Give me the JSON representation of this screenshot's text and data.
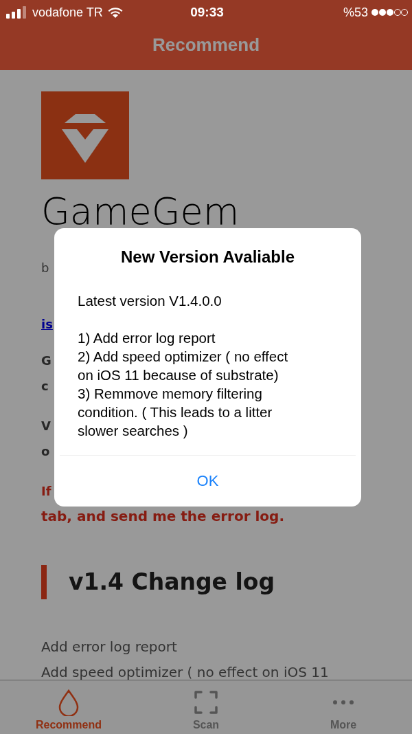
{
  "status_bar": {
    "carrier": "vodafone TR",
    "time": "09:33",
    "battery": "%53"
  },
  "nav_bar": {
    "title": "Recommend"
  },
  "page": {
    "app_name": "GameGem",
    "paragraphs": [
      {
        "kind": "byline",
        "lines": [
          "b"
        ]
      },
      {
        "kind": "link",
        "lines": [
          "is"
        ]
      },
      {
        "kind": "bold",
        "lines": [
          "G",
          "c"
        ]
      },
      {
        "kind": "bold",
        "lines": [
          "V",
          "o"
        ]
      },
      {
        "kind": "warning",
        "lines": [
          "If",
          "tab, and send me the error log."
        ]
      }
    ],
    "heading": "v1.4 Change log",
    "changes": [
      "Add error log report",
      "Add speed optimizer ( no effect on iOS 11"
    ]
  },
  "dialog": {
    "title": "New Version Avaliable",
    "intro": "Latest version V1.4.0.0",
    "lines": [
      "1) Add error log report",
      "2) Add speed optimizer ( no effect",
      "on iOS 11 because of substrate)",
      "3) Remmove memory filtering",
      "condition. ( This leads to a litter",
      "slower searches )"
    ],
    "button": "OK"
  },
  "tab_bar": [
    {
      "label": "Recommend",
      "selected": true
    },
    {
      "label": "Scan",
      "selected": false
    },
    {
      "label": "More",
      "selected": false
    }
  ]
}
